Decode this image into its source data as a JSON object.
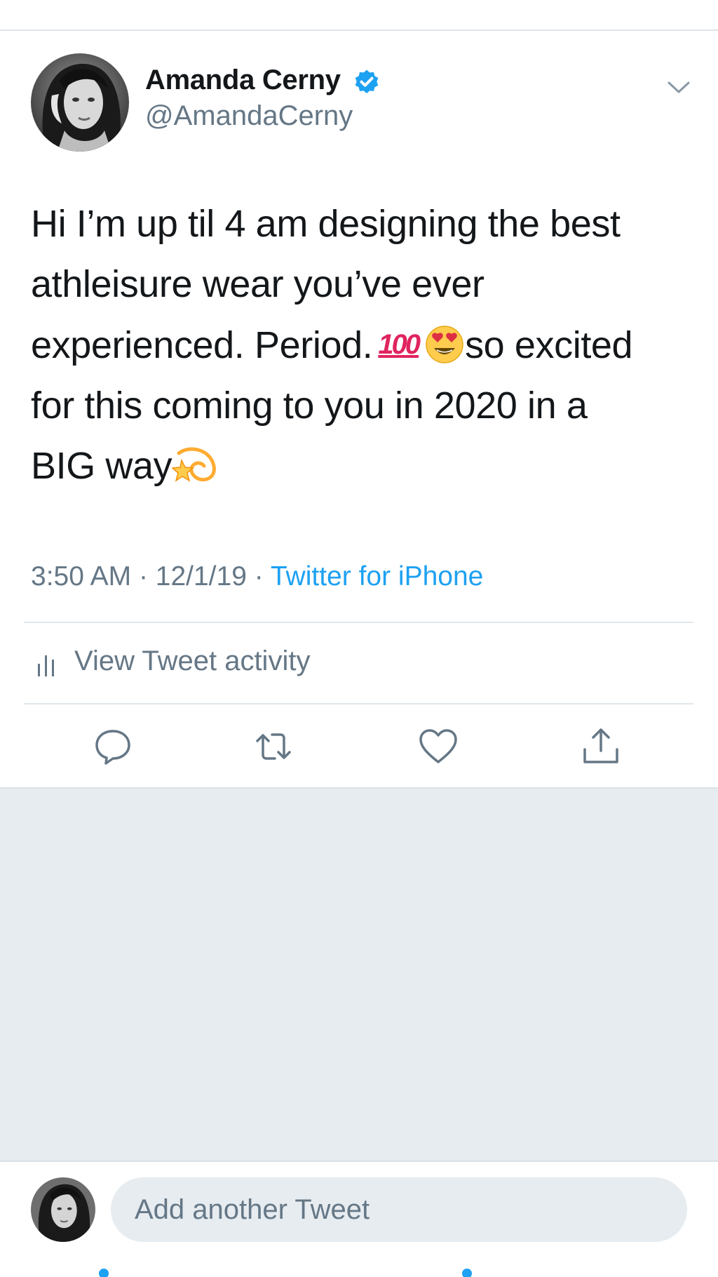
{
  "tweet": {
    "author_name": "Amanda Cerny",
    "author_handle": "@AmandaCerny",
    "text_lines": [
      "Hi I’m up til 4 am designing the best",
      "athleisure wear you’ve ever",
      "experienced. Period.",
      "so excited",
      "for this coming to you in 2020 in a",
      "BIG way"
    ],
    "emojis": [
      "hundred-points-emoji",
      "heart-eyes-emoji",
      "dizzy-emoji"
    ],
    "hundred_glyph": "100",
    "time": "3:50 AM",
    "date": "12/1/19",
    "separator": "·",
    "source": "Twitter for iPhone"
  },
  "activity": {
    "label": "View Tweet activity",
    "icon": "bar-chart-icon"
  },
  "actions": [
    {
      "name": "reply",
      "icon": "reply-icon"
    },
    {
      "name": "retweet",
      "icon": "retweet-icon"
    },
    {
      "name": "like",
      "icon": "heart-icon"
    },
    {
      "name": "share",
      "icon": "share-icon"
    }
  ],
  "composer": {
    "placeholder": "Add another Tweet"
  },
  "colors": {
    "accent": "#1da1f2",
    "text_primary": "#14171a",
    "text_secondary": "#657786",
    "background_empty": "#e6ecf0"
  }
}
